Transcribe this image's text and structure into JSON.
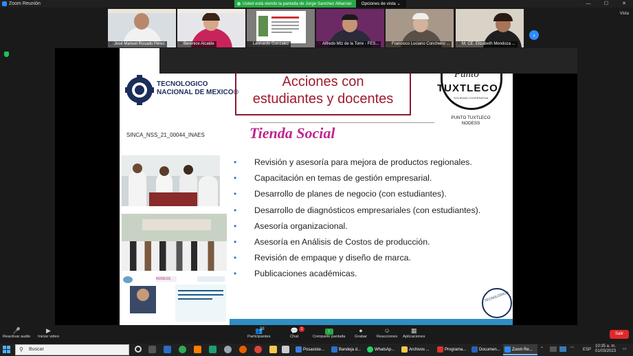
{
  "window": {
    "title": "Zoom Reunión",
    "controls": [
      "—",
      "☐",
      "✕"
    ]
  },
  "share_banner": {
    "text": "Usted está viendo la pantalla de Jorge Sanchez Albarran",
    "options_label": "Opciones de vista ⌄"
  },
  "video_strip": {
    "view_label": "Vista",
    "participants": [
      {
        "name": "José Manuel Rosado Pérez"
      },
      {
        "name": "Berenice Alcalde"
      },
      {
        "name": "Leonardo Gonzalez"
      },
      {
        "name": "Alfredo Mtz de la Torre - FES..."
      },
      {
        "name": "Francisco Luciano Concheiro ..."
      },
      {
        "name": "M. CE. Elizabeth Mendoza ..."
      }
    ]
  },
  "slide": {
    "org_name": "TECNOLOGICO\nNACIONAL DE MEXICO®",
    "title": "Acciones con\nestudiantes y docentes",
    "partner_logo": "TUXTLECO",
    "partner_logo_top": "Punto",
    "partner_logo_sub": "SOCIEDAD COOPERATIVA",
    "partner_caption": "PUNTO TUXTLECO\nNODESS",
    "doc_code": "SINCA_NSS_21_00044_INAES",
    "section_title": "Tienda Social",
    "bullets": [
      "Revisión y asesoría para mejora de productos regionales.",
      "Capacitación en temas de gestión empresarial.",
      "Desarrollo de planes de negocio (con estudiantes).",
      "Desarrollo de diagnósticos empresariales (con estudiantes).",
      "Asesoría organizacional.",
      "Asesoría en Análisis de Costos de producción.",
      "Revisión de empaque y diseño de marca.",
      "Publicaciones académicas."
    ],
    "nodess_label": "NODESS",
    "stamp_text": "TECNOLOGICO"
  },
  "toolbar": {
    "mute_label": "Reactivar audio",
    "video_label": "Iniciar video",
    "participants_label": "Participantes",
    "participants_count": "38",
    "chat_label": "Chat",
    "chat_badge": "1",
    "share_label": "Compartir pantalla",
    "record_label": "Grabar",
    "reactions_label": "Reacciones",
    "apps_label": "Aplicaciones",
    "leave_label": "Salir"
  },
  "taskbar": {
    "search_placeholder": "Buscar",
    "apps": [
      {
        "label": "Posasiste...",
        "color": "#3b7ddd"
      },
      {
        "label": "Bandeja d...",
        "color": "#2a72c8"
      },
      {
        "label": "WhatsAp...",
        "color": "#25d366"
      },
      {
        "label": "Archivos ...",
        "color": "#f2c94c"
      },
      {
        "label": "Programa...",
        "color": "#d9342b"
      },
      {
        "label": "Documen...",
        "color": "#2b5fb8"
      },
      {
        "label": "Zoom Re...",
        "color": "#2d8cff"
      }
    ],
    "language": "ESP",
    "time": "10:35 a. m.",
    "date": "01/03/2023"
  },
  "colors": {
    "zoom_blue": "#2d8cff",
    "banner_green": "#28a745",
    "leave_red": "#e02828",
    "slide_title": "#a01a2c",
    "section_title": "#c0258e"
  }
}
